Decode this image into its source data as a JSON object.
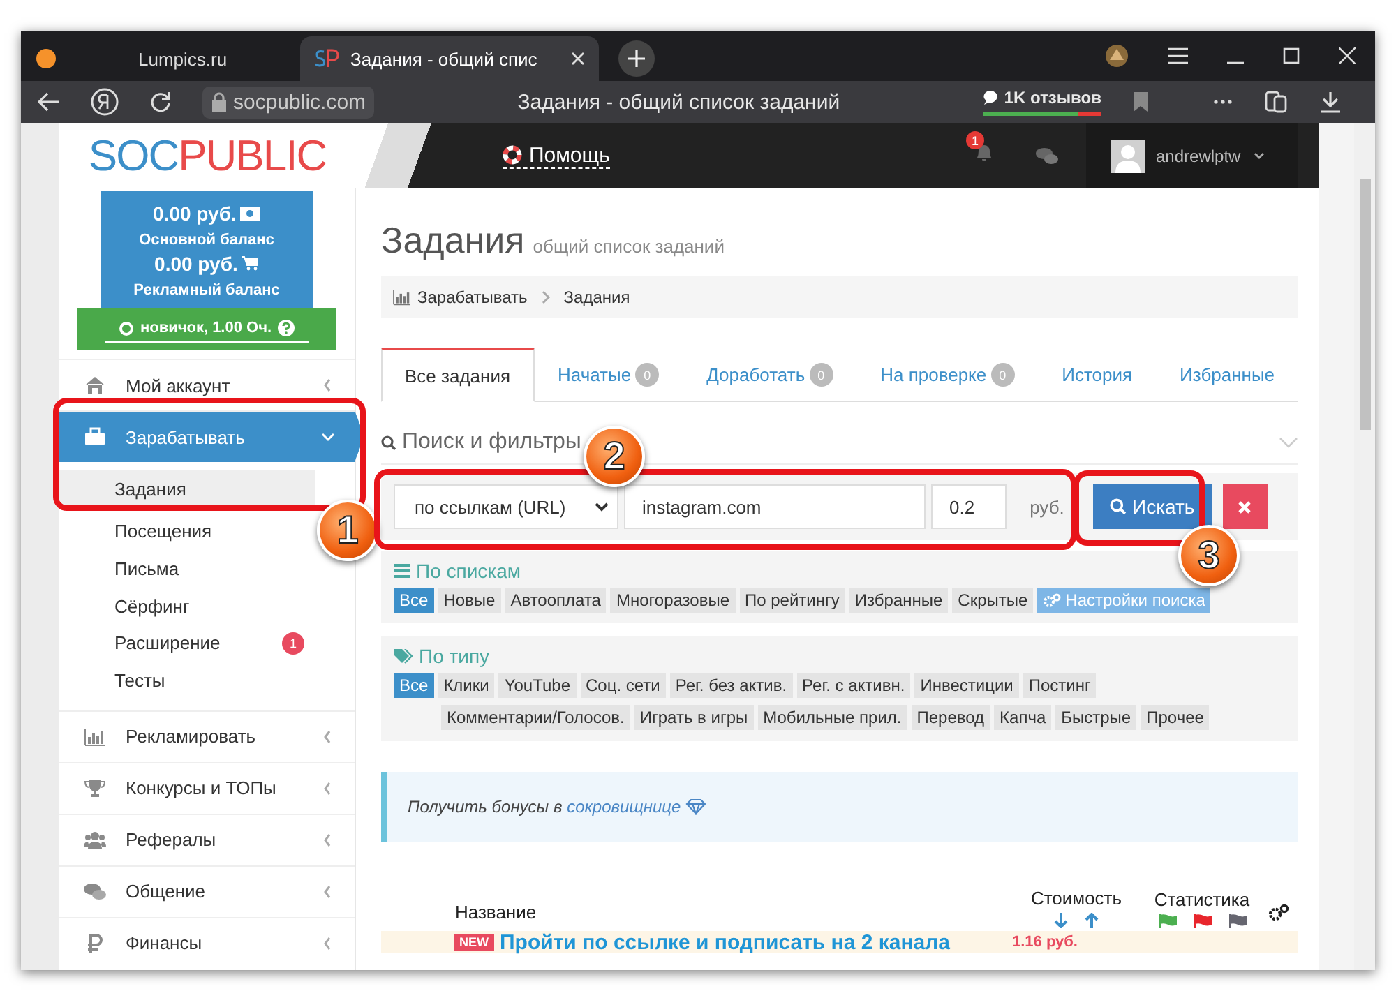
{
  "browser": {
    "tabs": [
      {
        "title": "Lumpics.ru",
        "selected": false
      },
      {
        "title": "Задания - общий спис",
        "selected": true
      }
    ],
    "address": "socpublic.com",
    "page_title": "Задания - общий список заданий",
    "reviews": "1K отзывов"
  },
  "site_header": {
    "logo_first": "SOC",
    "logo_second": "PUBLIC",
    "help": "Помощь",
    "notifications": "1",
    "user": "andrewlptw"
  },
  "sidebar": {
    "balance": {
      "main_amount": "0.00 руб.",
      "main_label": "Основной баланс",
      "ad_amount": "0.00 руб.",
      "ad_label": "Рекламный баланс"
    },
    "rank": "новичок, 1.00 Оч.",
    "menu": [
      {
        "label": "Мой аккаунт",
        "selected": false,
        "expanded": false
      },
      {
        "label": "Зарабатывать",
        "selected": true,
        "expanded": true,
        "children": [
          {
            "label": "Задания",
            "selected": true
          },
          {
            "label": "Посещения",
            "selected": false
          },
          {
            "label": "Письма",
            "selected": false
          },
          {
            "label": "Сёрфинг",
            "selected": false
          },
          {
            "label": "Расширение",
            "selected": false,
            "badge": "1"
          },
          {
            "label": "Тесты",
            "selected": false
          }
        ]
      },
      {
        "label": "Рекламировать",
        "selected": false,
        "expanded": false
      },
      {
        "label": "Конкурсы и ТОПы",
        "selected": false,
        "expanded": false
      },
      {
        "label": "Рефералы",
        "selected": false,
        "expanded": false
      },
      {
        "label": "Общение",
        "selected": false,
        "expanded": false
      },
      {
        "label": "Финансы",
        "selected": false,
        "expanded": false
      }
    ]
  },
  "main": {
    "title": "Задания",
    "subtitle": "общий список заданий",
    "breadcrumb": [
      "Зарабатывать",
      "Задания"
    ],
    "tabs": [
      {
        "label": "Все задания",
        "selected": true
      },
      {
        "label": "Начатые",
        "count": "0",
        "selected": false
      },
      {
        "label": "Доработать",
        "count": "0",
        "selected": false
      },
      {
        "label": "На проверке",
        "count": "0",
        "selected": false
      },
      {
        "label": "История",
        "selected": false
      },
      {
        "label": "Избранные",
        "selected": false
      }
    ],
    "search": {
      "title": "Поиск и фильтры",
      "mode": "по ссылкам (URL)",
      "query": "instagram.com",
      "price": "0.2",
      "currency": "руб.",
      "button": "Искать"
    },
    "lists": {
      "title": "По спискам",
      "chips": [
        {
          "label": "Все",
          "selected": true
        },
        {
          "label": "Новые",
          "selected": false
        },
        {
          "label": "Автооплата",
          "selected": false
        },
        {
          "label": "Многоразовые",
          "selected": false
        },
        {
          "label": "По рейтингу",
          "selected": false
        },
        {
          "label": "Избранные",
          "selected": false
        },
        {
          "label": "Скрытые",
          "selected": false
        }
      ],
      "settings": "Настройки поиска"
    },
    "types": {
      "title": "По типу",
      "chips": [
        {
          "label": "Все",
          "selected": true
        },
        {
          "label": "Клики",
          "selected": false
        },
        {
          "label": "YouTube",
          "selected": false
        },
        {
          "label": "Соц. сети",
          "selected": false
        },
        {
          "label": "Рег. без актив.",
          "selected": false
        },
        {
          "label": "Рег. с активн.",
          "selected": false
        },
        {
          "label": "Инвестиции",
          "selected": false
        },
        {
          "label": "Постинг",
          "selected": false
        },
        {
          "label": "Комментарии/Голосов.",
          "selected": false
        },
        {
          "label": "Играть в игры",
          "selected": false
        },
        {
          "label": "Мобильные прил.",
          "selected": false
        },
        {
          "label": "Перевод",
          "selected": false
        },
        {
          "label": "Капча",
          "selected": false
        },
        {
          "label": "Быстрые",
          "selected": false
        },
        {
          "label": "Прочее",
          "selected": false
        }
      ]
    },
    "bonus": {
      "text": "Получить бонусы в ",
      "link": "сокровищнице"
    },
    "table": {
      "columns": {
        "name": "Название",
        "cost": "Стоимость",
        "stats": "Статистика"
      },
      "stat_flags": [
        {
          "color": "#4caf50"
        },
        {
          "color": "#e8262c"
        },
        {
          "color": "#666670"
        }
      ],
      "rows": [
        {
          "badge": "NEW",
          "title": "Пройти по ссылке и подписать на 2 канала",
          "price": "1.16 руб."
        }
      ]
    }
  },
  "annotations": [
    {
      "number": "1"
    },
    {
      "number": "2"
    },
    {
      "number": "3"
    }
  ]
}
